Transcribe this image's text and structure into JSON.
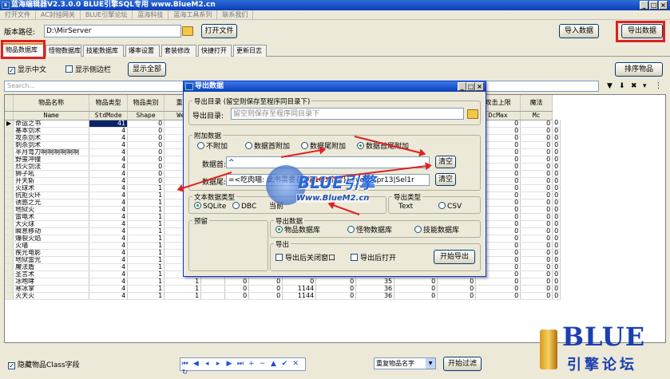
{
  "window": {
    "title": "蓝海编辑器V2.3.0.0  BLUE引擎SQL专用   www.BlueM2.cn",
    "icon": "app-icon"
  },
  "menu": [
    "打开文件",
    "AC封挂网关",
    "BLUE引擎论坛",
    "蓝海科技",
    "蓝海工具系列",
    "联系我们"
  ],
  "toolbar": {
    "path_label": "版本路径:",
    "path_value": "D:\\MirServer",
    "open_file": "打开文件",
    "import_data": "导入数据",
    "export_data": "导出数据"
  },
  "tabs": [
    "物品数据库",
    "怪物数据库",
    "技能数据库",
    "爆率设置",
    "套装修改",
    "快捷打开",
    "更新日志"
  ],
  "options": {
    "show_chinese": "显示中文",
    "show_sidebar": "显示侧边栏",
    "show_all": "显示全部",
    "sort_items": "排序物品"
  },
  "search_placeholder": "Search...",
  "columns": [
    {
      "cn": "物品名称",
      "en": "Name"
    },
    {
      "cn": "物品类型",
      "en": "StdMode"
    },
    {
      "cn": "物品类别",
      "en": "Shape"
    },
    {
      "cn": "重量",
      "en": "Wei"
    },
    {
      "cn": "",
      "en": ""
    },
    {
      "cn": "",
      "en": ""
    },
    {
      "cn": "",
      "en": ""
    },
    {
      "cn": "",
      "en": ""
    },
    {
      "cn": "",
      "en": ""
    },
    {
      "cn": "魔御",
      "en": "Mac"
    },
    {
      "cn": "魔御上限",
      "en": "MacMax"
    },
    {
      "cn": "攻击",
      "en": "Dc"
    },
    {
      "cn": "攻击上限",
      "en": "DcMax"
    },
    {
      "cn": "魔法",
      "en": "Mc"
    }
  ],
  "rows": [
    {
      "name": "命运之书",
      "v": [
        "41",
        "0",
        "",
        "",
        "",
        "",
        "",
        "",
        "",
        "0",
        "0",
        "0",
        "0",
        "0"
      ]
    },
    {
      "name": "基本剑术",
      "v": [
        "4",
        "0",
        "",
        "",
        "",
        "",
        "",
        "",
        "",
        "0",
        "0",
        "0",
        "0",
        "0"
      ]
    },
    {
      "name": "攻杀剑术",
      "v": [
        "4",
        "0",
        "",
        "",
        "",
        "",
        "",
        "",
        "",
        "0",
        "0",
        "0",
        "0",
        "0"
      ]
    },
    {
      "name": "刺杀剑术",
      "v": [
        "4",
        "0",
        "",
        "",
        "",
        "",
        "",
        "",
        "",
        "0",
        "0",
        "0",
        "0",
        "0"
      ]
    },
    {
      "name": "半月弯刀啊啊啊啊啊啊",
      "v": [
        "4",
        "0",
        "",
        "",
        "",
        "",
        "",
        "",
        "",
        "0",
        "0",
        "0",
        "0",
        "0"
      ]
    },
    {
      "name": "野蛮冲撞",
      "v": [
        "4",
        "0",
        "",
        "",
        "",
        "",
        "",
        "",
        "",
        "0",
        "0",
        "0",
        "0",
        "0"
      ]
    },
    {
      "name": "烈火剑法",
      "v": [
        "4",
        "0",
        "",
        "",
        "",
        "",
        "",
        "",
        "",
        "0",
        "0",
        "0",
        "0",
        "0"
      ]
    },
    {
      "name": "狮子吼",
      "v": [
        "4",
        "0",
        "",
        "",
        "",
        "",
        "",
        "",
        "",
        "0",
        "0",
        "0",
        "0",
        "0"
      ]
    },
    {
      "name": "开天斩",
      "v": [
        "4",
        "0",
        "",
        "",
        "",
        "",
        "",
        "",
        "",
        "0",
        "0",
        "0",
        "0",
        "0"
      ]
    },
    {
      "name": "火球术",
      "v": [
        "4",
        "1",
        "",
        "",
        "",
        "",
        "",
        "",
        "",
        "0",
        "0",
        "0",
        "0",
        "0"
      ]
    },
    {
      "name": "抗拒火环",
      "v": [
        "4",
        "1",
        "",
        "",
        "",
        "",
        "",
        "",
        "",
        "0",
        "0",
        "0",
        "0",
        "0"
      ]
    },
    {
      "name": "诱惑之光",
      "v": [
        "4",
        "1",
        "",
        "",
        "",
        "",
        "",
        "",
        "",
        "0",
        "0",
        "0",
        "0",
        "0"
      ]
    },
    {
      "name": "地狱火",
      "v": [
        "4",
        "1",
        "",
        "",
        "",
        "",
        "",
        "",
        "",
        "0",
        "0",
        "0",
        "0",
        "0"
      ]
    },
    {
      "name": "雷电术",
      "v": [
        "4",
        "1",
        "",
        "",
        "",
        "",
        "",
        "",
        "",
        "0",
        "0",
        "0",
        "0",
        "0"
      ]
    },
    {
      "name": "大火球",
      "v": [
        "4",
        "1",
        "",
        "",
        "",
        "",
        "",
        "",
        "",
        "0",
        "0",
        "0",
        "0",
        "0"
      ]
    },
    {
      "name": "瞬息移动",
      "v": [
        "4",
        "1",
        "",
        "",
        "",
        "",
        "",
        "",
        "",
        "0",
        "0",
        "0",
        "0",
        "0"
      ]
    },
    {
      "name": "爆裂火焰",
      "v": [
        "4",
        "1",
        "",
        "",
        "",
        "",
        "",
        "",
        "",
        "0",
        "0",
        "0",
        "0",
        "0"
      ]
    },
    {
      "name": "火墙",
      "v": [
        "4",
        "1",
        "",
        "",
        "",
        "",
        "",
        "",
        "",
        "0",
        "0",
        "0",
        "0",
        "0"
      ]
    },
    {
      "name": "疾光电影",
      "v": [
        "4",
        "1",
        "1",
        "",
        "0",
        "0",
        "0",
        "0",
        "26",
        "0",
        "0",
        "0",
        "0",
        "0"
      ]
    },
    {
      "name": "地狱雷光",
      "v": [
        "4",
        "1",
        "1",
        "",
        "0",
        "0",
        "0",
        "0",
        "30",
        "0",
        "0",
        "0",
        "0",
        "0"
      ]
    },
    {
      "name": "魔法盾",
      "v": [
        "4",
        "1",
        "1",
        "",
        "0",
        "0",
        "0",
        "0",
        "31",
        "0",
        "0",
        "0",
        "0",
        "0"
      ]
    },
    {
      "name": "圣言术",
      "v": [
        "4",
        "1",
        "1",
        "",
        "0",
        "0",
        "0",
        "0",
        "32",
        "0",
        "0",
        "0",
        "0",
        "0"
      ]
    },
    {
      "name": "冰咆哮",
      "v": [
        "4",
        "1",
        "1",
        "",
        "0",
        "0",
        "0",
        "0",
        "35",
        "0",
        "0",
        "0",
        "0",
        "0"
      ]
    },
    {
      "name": "寒冰掌",
      "v": [
        "4",
        "1",
        "1",
        "",
        "0",
        "0",
        "1144",
        "0",
        "36",
        "0",
        "0",
        "0",
        "0",
        "0"
      ]
    },
    {
      "name": "灭天火",
      "v": [
        "4",
        "1",
        "1",
        "",
        "0",
        "0",
        "1144",
        "0",
        "36",
        "0",
        "0",
        "0",
        "0",
        "0"
      ]
    }
  ],
  "bottom": {
    "hide_class": "隐藏物品Class字段",
    "dup_combo": "重复物品名字",
    "start_filter": "开始过滤"
  },
  "dialog": {
    "title": "导出数据",
    "dir_group": "导出目录 (留空则保存至程序同目录下)",
    "dir_label": "导出目录:",
    "dir_placeholder": "留空则保存至程序同目录下",
    "attach_group": "附加数据",
    "attach_opts": [
      "不附加",
      "数据首附加",
      "数据尾附加",
      "数据首尾附加"
    ],
    "head_label": "数据首:",
    "head_value": "^",
    "tail_label": "数据尾:",
    "tail_value": "=<吃肉喵: 此书需要{等级100才能}Level>Spr13|Sel1r",
    "clear": "清空",
    "textdb_group": "文本数据类型",
    "textdb_opts": [
      "SQLite",
      "DBC"
    ],
    "textdb_extra": "当前",
    "type_group": "导出类型",
    "type_opts": [
      "Text",
      "CSV"
    ],
    "preview_group": "预留",
    "data_group": "导出数据",
    "data_opts": [
      "物品数据库",
      "怪物数据库",
      "技能数据库"
    ],
    "export_group": "导出",
    "close_after": "导出后关闭窗口",
    "open_after": "导出后打开",
    "start_export": "开始导出"
  },
  "watermark": {
    "text1": "BLUE引擎",
    "text2": "Www.BlueM2.cn"
  },
  "logo": {
    "text1": "BLUE",
    "text2": "引擎论坛"
  },
  "colors": {
    "accent": "#e02020",
    "titlebar": "#0a3fb8",
    "selection": "#0a246a"
  }
}
